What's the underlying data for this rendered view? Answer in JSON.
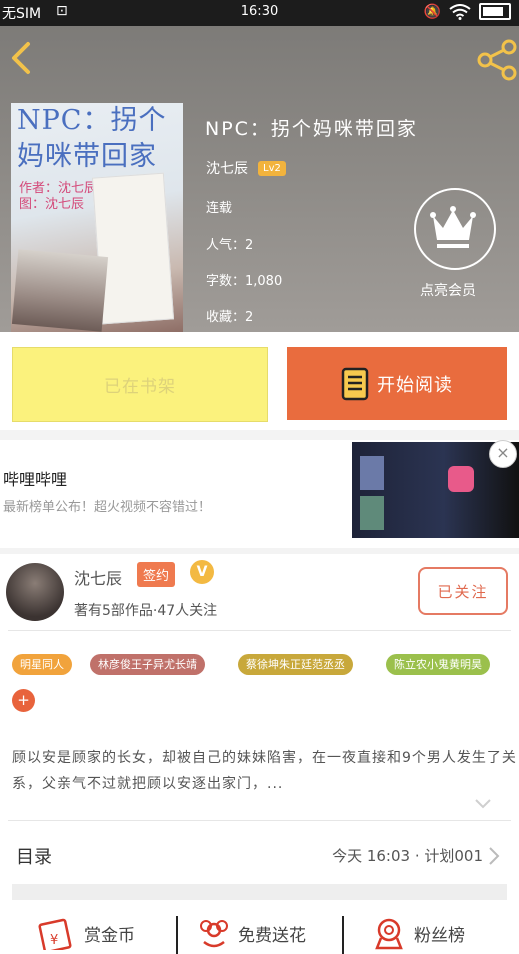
{
  "status_bar": {
    "carrier": "无SIM",
    "time": "16:30"
  },
  "header": {
    "icons": [
      "back-icon",
      "share-icon"
    ]
  },
  "cover": {
    "line1": "NPC：拐个",
    "line2": "妈咪带回家",
    "author_credit": "作者：沈七辰",
    "art_credit": "图：沈七辰"
  },
  "book": {
    "title": "NPC：拐个妈咪带回家",
    "author": "沈七辰",
    "level": "Lv2",
    "status": "连载",
    "popularity": "人气：2",
    "word_count": "字数：1,080",
    "collections": "收藏：2"
  },
  "vip": {
    "label": "点亮会员",
    "icon": "crown-icon"
  },
  "actions": {
    "shelf_label": "已在书架",
    "read_label": "开始阅读"
  },
  "ad": {
    "title": "哔哩哔哩",
    "subtitle": "最新榜单公布！超火视频不容错过！"
  },
  "author_card": {
    "name": "沈七辰",
    "badge": "签约",
    "v_badge": "V",
    "stats": "著有5部作品·47人关注",
    "follow_label": "已关注"
  },
  "tags": [
    "明星同人",
    "林彦俊王子异尤长靖",
    "蔡徐坤朱正廷范丞丞",
    "陈立农小鬼黄明昊"
  ],
  "tag_colors": [
    "#f1a33c",
    "#c0716a",
    "#c8a83b",
    "#9bc04c"
  ],
  "synopsis": "顾以安是顾家的长女，却被自己的妹妹陷害，在一夜直接和9个男人发生了关系，父亲气不过就把顾以安逐出家门，...",
  "toc": {
    "label": "目录",
    "latest": "今天 16:03 · 计划001"
  },
  "bottom_bar": {
    "reward_label": "赏金币",
    "flower_label": "免费送花",
    "fans_label": "粉丝榜"
  },
  "colors": {
    "accent_orange": "#e96c3e",
    "shelf_yellow": "#fbf27d"
  }
}
